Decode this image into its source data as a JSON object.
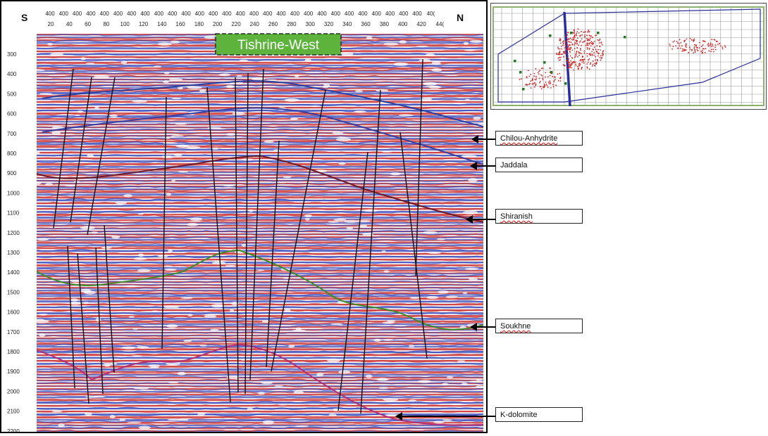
{
  "section": {
    "left_label": "S",
    "right_label": "N",
    "title": "Tishrine-West",
    "top_ticks_row1": [
      "400",
      "400",
      "400",
      "400",
      "400",
      "400",
      "400",
      "400",
      "400",
      "400",
      "400",
      "400",
      "400",
      "400",
      "400",
      "400",
      "400",
      "400",
      "400",
      "400",
      "400",
      "400",
      "400",
      "400",
      "400",
      "400",
      "400",
      "400",
      "40("
    ],
    "top_ticks_row2": [
      "20",
      "40",
      "60",
      "80",
      "100",
      "120",
      "140",
      "160",
      "180",
      "200",
      "220",
      "240",
      "260",
      "280",
      "300",
      "320",
      "340",
      "360",
      "380",
      "400",
      "420",
      "44("
    ],
    "depth_ticks": [
      "300",
      "400",
      "500",
      "600",
      "700",
      "800",
      "900",
      "1000",
      "1100",
      "1200",
      "1300",
      "1400",
      "1500",
      "1600",
      "1700",
      "1800",
      "1900",
      "2000",
      "2100",
      "2200"
    ]
  },
  "horizons": [
    {
      "name": "Chilou-Anhydrite",
      "color": "#2b3f9e"
    },
    {
      "name": "Jaddala",
      "color": "#3a3fa0"
    },
    {
      "name": "Shiranish",
      "color": "#6a1a2a"
    },
    {
      "name": "Soukhne",
      "color": "#3f8a2a"
    },
    {
      "name": "K-dolomite",
      "color": "#b0307a"
    }
  ],
  "colors": {
    "title_bg": "#5db33b",
    "seismic_red": "#cf3a3a",
    "seismic_blue": "#3a4fbf",
    "fault": "#111111",
    "basemap_grid": "#999999",
    "basemap_frame": "#2a2f9a",
    "basemap_points": "#d02020",
    "basemap_wells": "#1f7a1f",
    "basemap_outer_frame": "#8fb070"
  }
}
